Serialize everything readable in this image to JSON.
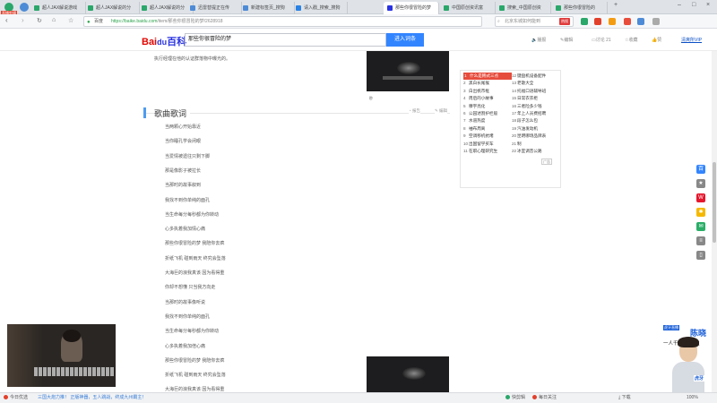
{
  "browser": {
    "live_badge": "直播剪辑",
    "tabs": [
      {
        "title": "超人JAX解说游戏",
        "color": "#2aa76a"
      },
      {
        "title": "超人JAX解说的分",
        "color": "#2aa76a"
      },
      {
        "title": "超人JAX解说的分",
        "color": "#2aa76a"
      },
      {
        "title": "迅雷替提正在传",
        "color": "#4e8bd6"
      },
      {
        "title": "新建标签页_搜狗",
        "color": "#4e8bd6"
      },
      {
        "title": "请入戳_搜索_搜狗",
        "color": "#2a82e4"
      },
      {
        "title": "那些你很冒险的梦",
        "color": "#2932e1"
      },
      {
        "title": "中国原创资讯富",
        "color": "#2aa76a"
      },
      {
        "title": "搜索_中国原创资",
        "color": "#2aa76a"
      },
      {
        "title": "那些你很冒险的",
        "color": "#2aa76a"
      }
    ],
    "new_tab": "+",
    "window_controls": [
      "–",
      "□",
      "×"
    ],
    "url_prefix": "百度",
    "url_host": "https://baike.baidu.com",
    "url_path": "/item/那些你很冒险的梦/2628918",
    "search_placeholder": "北京东城如何能到",
    "search_hot": "热搜"
  },
  "baike_header": {
    "logo_main": "Bai",
    "logo_paw": "du",
    "logo_tail": "百科",
    "query": "那些你很冒险的梦",
    "enter_button": "进入词条",
    "tools": [
      "播报",
      "编辑",
      "讨论 21",
      "收藏",
      "赞",
      "清爽所VIP"
    ]
  },
  "content": {
    "intro": "执行经理在他的认证群落物中曝光的。",
    "thumb_caption": "秒",
    "section_title": "歌曲歌词",
    "section_tools": [
      "报告",
      "编辑"
    ],
    "lyrics": [
      "当两颗心开始靠近",
      "当你睡孔学会闭眼",
      "当爱情被遗往只剩下脚",
      "那是像影子被拉长",
      "当那时的故事叙到",
      "我找不到你单纯的面孔",
      "当生命每分每秒都为你转动",
      "心多执着我加情心痛",
      "那些你很冒险的梦 我陪你去疯",
      "折纸飞机 碰到雨天 终究会坠落",
      "大海巨的浪我真该 因为看得重",
      "你却不想懂 只当我方向走",
      "当那时的故事像听说",
      "我找不到你单纯的面孔",
      "当生命每分每秒都为你转动",
      "心多执着我加倍心痛",
      "那些你很冒险的梦 我陪你去疯",
      "折纸飞机 碰到雨天 终究会坠落",
      "大海巨的浪我真该 因为看得重"
    ]
  },
  "rank": {
    "left": [
      {
        "num": "1",
        "text": "什么是韩式三点"
      },
      {
        "num": "2",
        "text": "黑白长尾猴"
      },
      {
        "num": "3",
        "text": "白出帆市框"
      },
      {
        "num": "4",
        "text": "周后的小故事"
      },
      {
        "num": "5",
        "text": "穆宇亮化"
      },
      {
        "num": "6",
        "text": "公园述割护栏般"
      },
      {
        "num": "7",
        "text": "水道热度"
      },
      {
        "num": "8",
        "text": "袖布周离"
      },
      {
        "num": "9",
        "text": "空调移机抗堵"
      },
      {
        "num": "10",
        "text": "出国留学买车"
      },
      {
        "num": "11",
        "text": "在职心理研究生"
      }
    ],
    "right": [
      {
        "num": "12",
        "text": "键盘机设备配件"
      },
      {
        "num": "13",
        "text": "老歌大全"
      },
      {
        "num": "14",
        "text": "托福口语辅导班"
      },
      {
        "num": "15",
        "text": "日常衣衣柜"
      },
      {
        "num": "16",
        "text": "三者险多少钱"
      },
      {
        "num": "17",
        "text": "年上人员费招聘"
      },
      {
        "num": "18",
        "text": "段子怎么包"
      },
      {
        "num": "19",
        "text": "汽油发动机"
      },
      {
        "num": "20",
        "text": "昆明哪场品牌表"
      },
      {
        "num": "21",
        "text": "制"
      },
      {
        "num": "22",
        "text": "冰室调音公路"
      }
    ],
    "ad_label": "广告"
  },
  "share": [
    {
      "icon": "baike-icon",
      "glyph": "百",
      "color": "#3385ff"
    },
    {
      "icon": "star-icon",
      "glyph": "★",
      "color": "#888888"
    },
    {
      "icon": "weibo-icon",
      "glyph": "W",
      "color": "#e6162d"
    },
    {
      "icon": "qzone-icon",
      "glyph": "✱",
      "color": "#f5b800"
    },
    {
      "icon": "wechat-icon",
      "glyph": "✉",
      "color": "#2aae67"
    },
    {
      "icon": "feedback-icon",
      "glyph": "≡",
      "color": "#888888"
    },
    {
      "icon": "phone-icon",
      "glyph": "▯",
      "color": "#888888"
    }
  ],
  "streamer": {
    "badge": "虎牙直播",
    "name": "陈晓",
    "slogan": "一人千面百'晓'生",
    "tag": "虎牙"
  },
  "statusbar": {
    "left": "今日优选",
    "news": "三国大炮力推！ 正版神器，五人跳战，终成九州霸主！",
    "middle": "快剪辑",
    "right": [
      "每日关注",
      "下载",
      "100%"
    ]
  }
}
